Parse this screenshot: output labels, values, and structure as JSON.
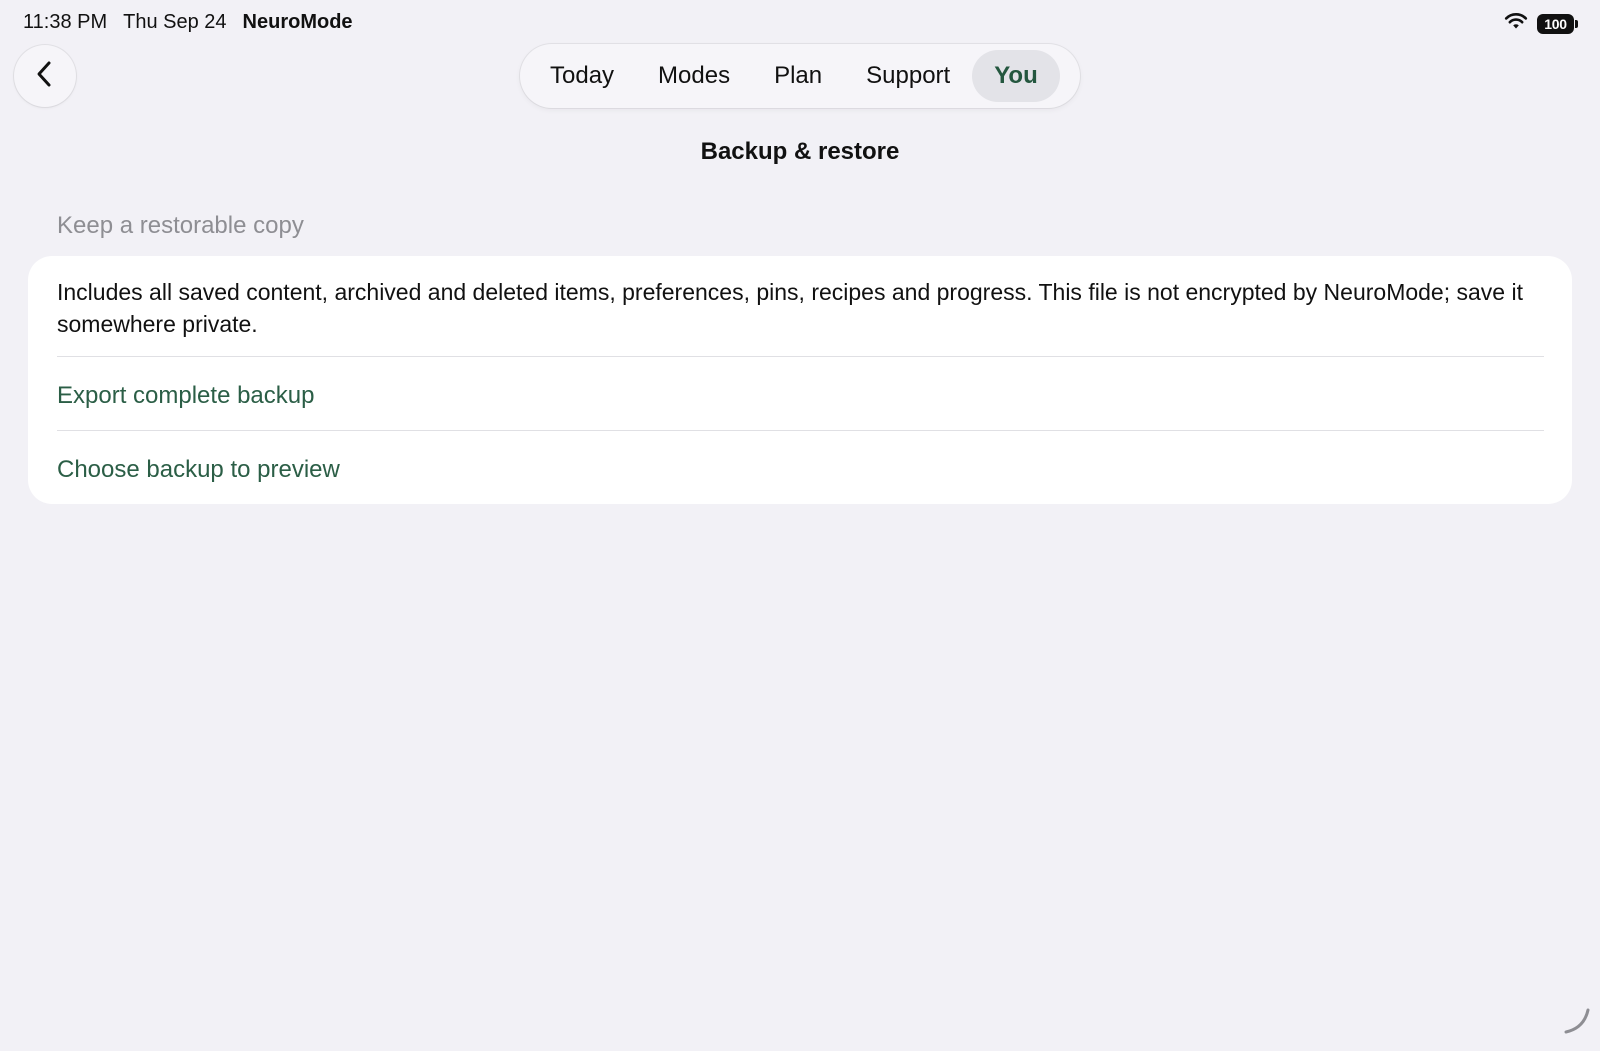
{
  "status_bar": {
    "time": "11:38 PM",
    "date": "Thu Sep 24",
    "app_name": "NeuroMode",
    "battery_level": "100",
    "wifi_icon": "wifi-icon"
  },
  "nav": {
    "back_icon": "chevron-left-icon",
    "tabs": [
      {
        "label": "Today",
        "active": false
      },
      {
        "label": "Modes",
        "active": false
      },
      {
        "label": "Plan",
        "active": false
      },
      {
        "label": "Support",
        "active": false
      },
      {
        "label": "You",
        "active": true
      }
    ]
  },
  "page": {
    "title": "Backup & restore",
    "section_header": "Keep a restorable copy",
    "description": "Includes all saved content, archived and deleted items, preferences, pins, recipes and progress. This file is not encrypted by NeuroMode; save it somewhere private.",
    "actions": [
      {
        "label": "Export complete backup"
      },
      {
        "label": "Choose backup to preview"
      }
    ]
  },
  "colors": {
    "background": "#f2f1f6",
    "card": "#ffffff",
    "accent": "#2b5e46",
    "secondary_text": "#8e8e93",
    "active_tab_bg": "#e3e3e8"
  }
}
